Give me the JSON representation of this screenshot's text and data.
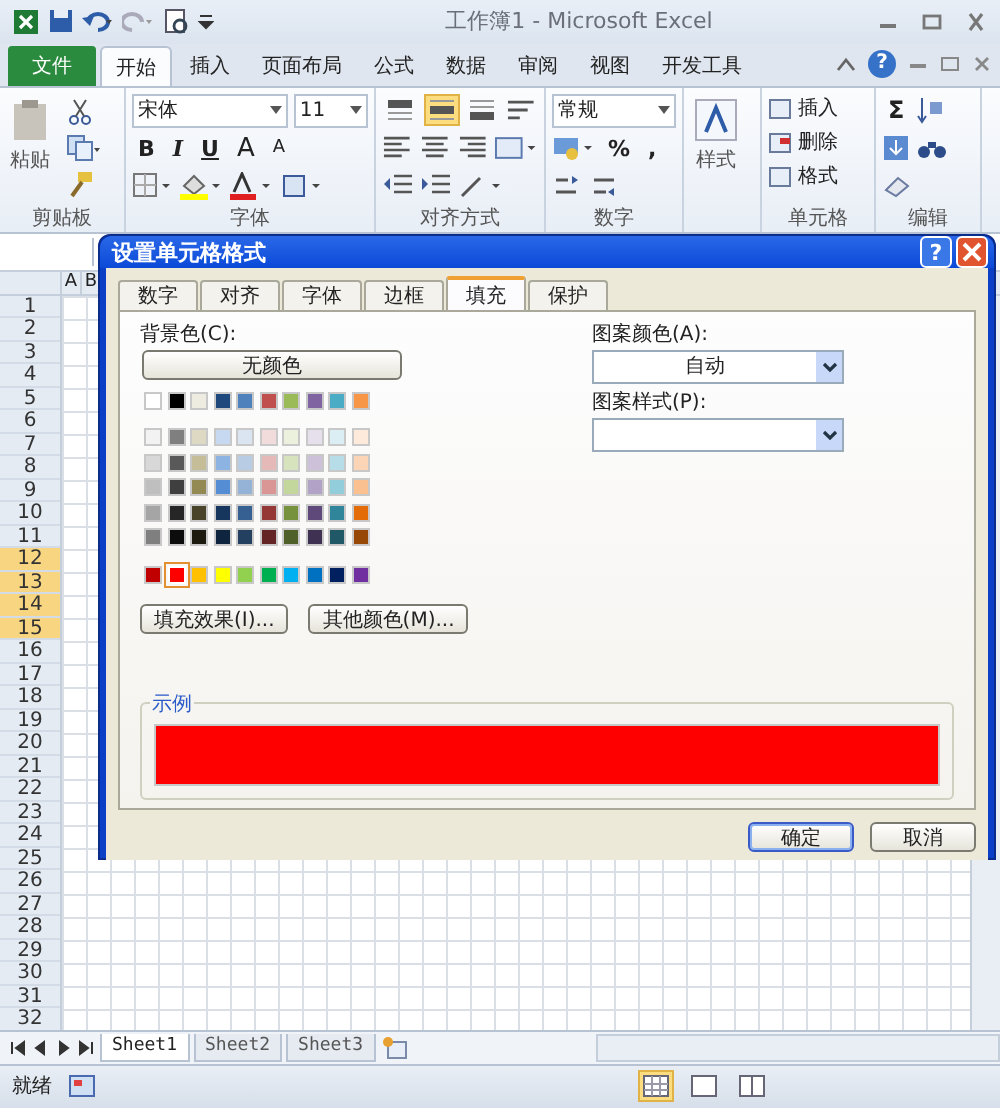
{
  "title_bar": {
    "title": "工作簿1 - Microsoft Excel"
  },
  "ribbon_tabs": [
    {
      "label": "文件",
      "kind": "file",
      "selected": false
    },
    {
      "label": "开始",
      "kind": "tab",
      "selected": true
    },
    {
      "label": "插入",
      "kind": "tab",
      "selected": false
    },
    {
      "label": "页面布局",
      "kind": "tab",
      "selected": false
    },
    {
      "label": "公式",
      "kind": "tab",
      "selected": false
    },
    {
      "label": "数据",
      "kind": "tab",
      "selected": false
    },
    {
      "label": "审阅",
      "kind": "tab",
      "selected": false
    },
    {
      "label": "视图",
      "kind": "tab",
      "selected": false
    },
    {
      "label": "开发工具",
      "kind": "tab",
      "selected": false
    }
  ],
  "ribbon_help": "?",
  "ribbon": {
    "clipboard": {
      "paste": "粘贴",
      "label": "剪贴板"
    },
    "font": {
      "name": "宋体",
      "size": "11",
      "styles": [
        "B",
        "I",
        "U"
      ],
      "grow": "A",
      "shrink": "A",
      "label": "字体"
    },
    "alignment": {
      "top_row": [
        {
          "selected": false
        },
        {
          "selected": true
        },
        {
          "selected": false
        }
      ],
      "label": "对齐方式"
    },
    "number": {
      "format": "常规",
      "symbols": [
        "%",
        ","
      ],
      "label": "数字"
    },
    "styles": {
      "button": "样式"
    },
    "cells": {
      "items": [
        "插入",
        "删除",
        "格式"
      ],
      "label": "单元格"
    },
    "editing": {
      "sum": "Σ",
      "label": "编辑"
    }
  },
  "sheet": {
    "columns": [
      "A",
      "B"
    ],
    "rows": [
      {
        "label": "1",
        "selected": false
      },
      {
        "label": "2",
        "selected": false
      },
      {
        "label": "3",
        "selected": false
      },
      {
        "label": "4",
        "selected": false
      },
      {
        "label": "5",
        "selected": false
      },
      {
        "label": "6",
        "selected": false
      },
      {
        "label": "7",
        "selected": false
      },
      {
        "label": "8",
        "selected": false
      },
      {
        "label": "9",
        "selected": false
      },
      {
        "label": "10",
        "selected": false
      },
      {
        "label": "11",
        "selected": false
      },
      {
        "label": "12",
        "selected": true
      },
      {
        "label": "13",
        "selected": true
      },
      {
        "label": "14",
        "selected": true
      },
      {
        "label": "15",
        "selected": true
      },
      {
        "label": "16",
        "selected": false
      },
      {
        "label": "17",
        "selected": false
      },
      {
        "label": "18",
        "selected": false
      },
      {
        "label": "19",
        "selected": false
      },
      {
        "label": "20",
        "selected": false
      },
      {
        "label": "21",
        "selected": false
      },
      {
        "label": "22",
        "selected": false
      },
      {
        "label": "23",
        "selected": false
      },
      {
        "label": "24",
        "selected": false
      },
      {
        "label": "25",
        "selected": false
      },
      {
        "label": "26",
        "selected": false
      },
      {
        "label": "27",
        "selected": false
      },
      {
        "label": "28",
        "selected": false
      },
      {
        "label": "29",
        "selected": false
      },
      {
        "label": "30",
        "selected": false
      },
      {
        "label": "31",
        "selected": false
      },
      {
        "label": "32",
        "selected": false
      }
    ]
  },
  "sheet_tabs": [
    {
      "label": "Sheet1",
      "selected": true
    },
    {
      "label": "Sheet2",
      "selected": false
    },
    {
      "label": "Sheet3",
      "selected": false
    }
  ],
  "status_bar": {
    "text": "就绪"
  },
  "dialog": {
    "title": "设置单元格格式",
    "help": "?",
    "tabs": [
      {
        "label": "数字",
        "selected": false
      },
      {
        "label": "对齐",
        "selected": false
      },
      {
        "label": "字体",
        "selected": false
      },
      {
        "label": "边框",
        "selected": false
      },
      {
        "label": "填充",
        "selected": true
      },
      {
        "label": "保护",
        "selected": false
      }
    ],
    "background_label": "背景色(C):",
    "no_color": "无颜色",
    "palette_rows": [
      {
        "kind": "theme",
        "swatches": [
          {
            "color": "#ffffff",
            "selected": false
          },
          {
            "color": "#000000",
            "selected": false
          },
          {
            "color": "#eeece1",
            "selected": false
          },
          {
            "color": "#1f497d",
            "selected": false
          },
          {
            "color": "#4f81bd",
            "selected": false
          },
          {
            "color": "#c0504d",
            "selected": false
          },
          {
            "color": "#9bbb59",
            "selected": false
          },
          {
            "color": "#8064a2",
            "selected": false
          },
          {
            "color": "#4bacc6",
            "selected": false
          },
          {
            "color": "#f79646",
            "selected": false
          }
        ]
      },
      {
        "kind": "tint",
        "swatches": [
          {
            "color": "#f2f2f2",
            "selected": false
          },
          {
            "color": "#7f7f7f",
            "selected": false
          },
          {
            "color": "#ddd9c3",
            "selected": false
          },
          {
            "color": "#c6d9f0",
            "selected": false
          },
          {
            "color": "#dbe5f1",
            "selected": false
          },
          {
            "color": "#f2dcdb",
            "selected": false
          },
          {
            "color": "#ebf1dd",
            "selected": false
          },
          {
            "color": "#e5e0ec",
            "selected": false
          },
          {
            "color": "#dbeef3",
            "selected": false
          },
          {
            "color": "#fdeada",
            "selected": false
          }
        ]
      },
      {
        "kind": "tint",
        "swatches": [
          {
            "color": "#d8d8d8",
            "selected": false
          },
          {
            "color": "#595959",
            "selected": false
          },
          {
            "color": "#c4bd97",
            "selected": false
          },
          {
            "color": "#8db3e2",
            "selected": false
          },
          {
            "color": "#b8cce4",
            "selected": false
          },
          {
            "color": "#e5b9b7",
            "selected": false
          },
          {
            "color": "#d7e3bc",
            "selected": false
          },
          {
            "color": "#ccc1d9",
            "selected": false
          },
          {
            "color": "#b7dde8",
            "selected": false
          },
          {
            "color": "#fbd5b5",
            "selected": false
          }
        ]
      },
      {
        "kind": "tint",
        "swatches": [
          {
            "color": "#bfbfbf",
            "selected": false
          },
          {
            "color": "#3f3f3f",
            "selected": false
          },
          {
            "color": "#938953",
            "selected": false
          },
          {
            "color": "#548dd4",
            "selected": false
          },
          {
            "color": "#95b3d7",
            "selected": false
          },
          {
            "color": "#d99694",
            "selected": false
          },
          {
            "color": "#c3d69b",
            "selected": false
          },
          {
            "color": "#b2a2c7",
            "selected": false
          },
          {
            "color": "#92cddc",
            "selected": false
          },
          {
            "color": "#fac08f",
            "selected": false
          }
        ]
      },
      {
        "kind": "tint",
        "swatches": [
          {
            "color": "#a5a5a5",
            "selected": false
          },
          {
            "color": "#262626",
            "selected": false
          },
          {
            "color": "#494429",
            "selected": false
          },
          {
            "color": "#17365d",
            "selected": false
          },
          {
            "color": "#366092",
            "selected": false
          },
          {
            "color": "#953734",
            "selected": false
          },
          {
            "color": "#76923c",
            "selected": false
          },
          {
            "color": "#5f497a",
            "selected": false
          },
          {
            "color": "#31859b",
            "selected": false
          },
          {
            "color": "#e36c09",
            "selected": false
          }
        ]
      },
      {
        "kind": "tint",
        "swatches": [
          {
            "color": "#7f7f7f",
            "selected": false
          },
          {
            "color": "#0c0c0c",
            "selected": false
          },
          {
            "color": "#1d1b10",
            "selected": false
          },
          {
            "color": "#0f243e",
            "selected": false
          },
          {
            "color": "#244061",
            "selected": false
          },
          {
            "color": "#632423",
            "selected": false
          },
          {
            "color": "#4f6128",
            "selected": false
          },
          {
            "color": "#3f3151",
            "selected": false
          },
          {
            "color": "#205867",
            "selected": false
          },
          {
            "color": "#974806",
            "selected": false
          }
        ]
      },
      {
        "kind": "standard",
        "swatches": [
          {
            "color": "#c00000",
            "selected": false
          },
          {
            "color": "#ff0000",
            "selected": true
          },
          {
            "color": "#ffc000",
            "selected": false
          },
          {
            "color": "#ffff00",
            "selected": false
          },
          {
            "color": "#92d050",
            "selected": false
          },
          {
            "color": "#00b050",
            "selected": false
          },
          {
            "color": "#00b0f0",
            "selected": false
          },
          {
            "color": "#0070c0",
            "selected": false
          },
          {
            "color": "#002060",
            "selected": false
          },
          {
            "color": "#7030a0",
            "selected": false
          }
        ]
      }
    ],
    "fill_effects": "填充效果(I)...",
    "more_colors": "其他颜色(M)...",
    "pattern_color_label": "图案颜色(A):",
    "pattern_color": "自动",
    "pattern_style_label": "图案样式(P):",
    "sample_label": "示例",
    "buttons": [
      {
        "label": "确定",
        "default": true
      },
      {
        "label": "取消",
        "default": false
      }
    ]
  }
}
